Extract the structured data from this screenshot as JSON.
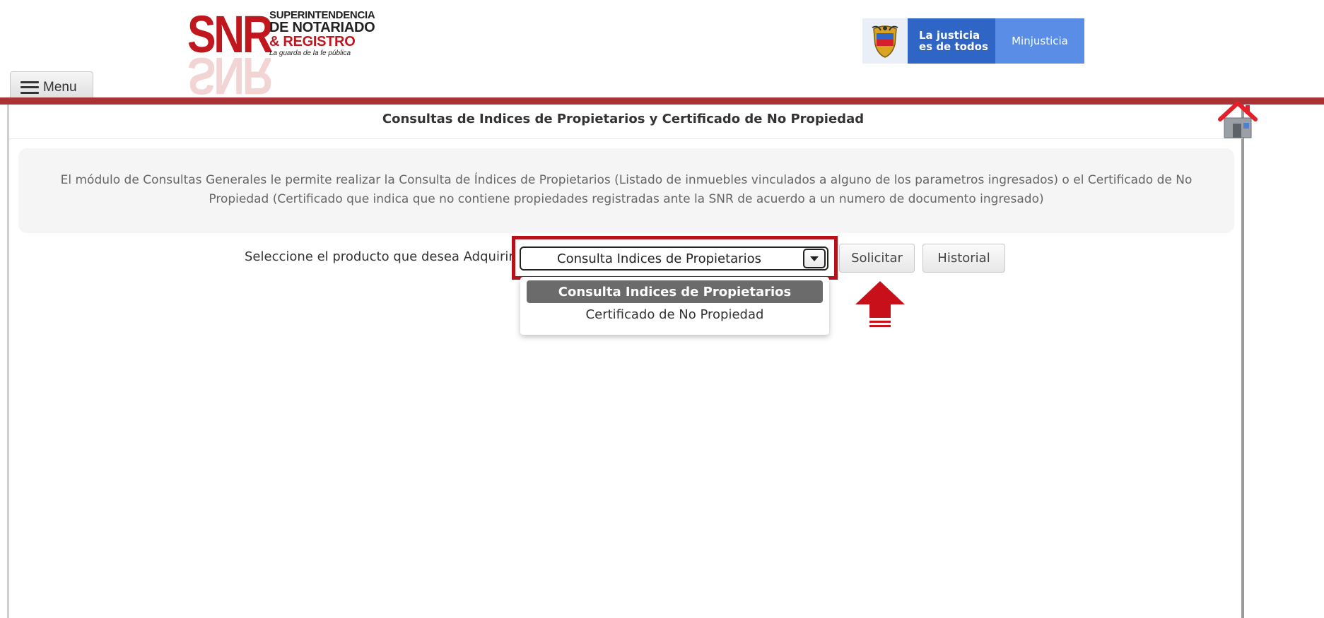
{
  "header": {
    "logo": {
      "acronym": "SNR",
      "line1": "SUPERINTENDENCIA",
      "line2": "DE NOTARIADO",
      "line3": "& REGISTRO",
      "tagline": "La guarda de la fe pública"
    },
    "gov_banner": {
      "slogan_line1": "La justicia",
      "slogan_line2": "es de todos",
      "ministry": "Minjusticia"
    },
    "menu_label": "Menu"
  },
  "page": {
    "title": "Consultas de Indices de Propietarios y Certificado de No Propiedad",
    "info_text": "El módulo de Consultas Generales le permite realizar la Consulta de Índices de Propietarios (Listado de inmuebles vinculados a alguno de los parametros ingresados) o el Certificado de No Propiedad (Certificado que indica que no contiene propiedades registradas ante la SNR de acuerdo a un numero de documento ingresado)"
  },
  "form": {
    "select_label": "Seleccione el producto que desea Adquirir",
    "selected_value": "Consulta Indices de Propietarios",
    "options": [
      "Consulta Indices de Propietarios",
      "Certificado de No Propiedad"
    ],
    "solicitar_label": "Solicitar",
    "historial_label": "Historial"
  },
  "colors": {
    "brand_red": "#c0161e",
    "header_bar": "#a83236",
    "highlight": "#b5121b",
    "gov_blue_dark": "#2f66c6",
    "gov_blue_light": "#5a8ee6"
  },
  "icons": [
    "hamburger-icon",
    "home-icon",
    "dropdown-arrow-icon",
    "red-up-arrow-icon",
    "colombia-shield-icon"
  ]
}
